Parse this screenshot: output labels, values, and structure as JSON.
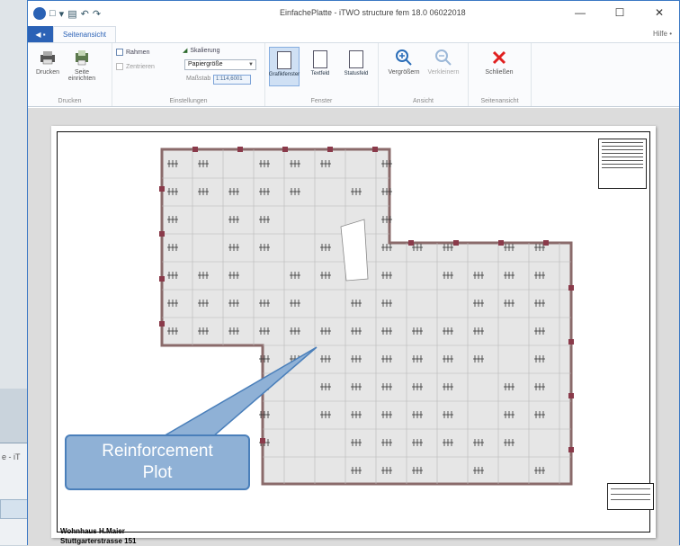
{
  "window": {
    "title": "EinfachePlatte - iTWO structure fem 18.0 06022018",
    "minimize": "—",
    "maximize": "☐",
    "close": "✕"
  },
  "tabs": {
    "file": "◀ ▪",
    "active": "Seitenansicht",
    "help": "Hilfe •"
  },
  "ribbon": {
    "drucken": {
      "print_label": "Drucken",
      "setup_label": "Seite einrichten",
      "group": "Drucken"
    },
    "einstellungen": {
      "rahmen": "Rahmen",
      "zentrieren": "Zentrieren",
      "skalierung": "Skalierung",
      "papiergroesse": "Papiergröße",
      "massstab_label": "Maßstab",
      "massstab_value": "1:114,6001",
      "group": "Einstellungen"
    },
    "fenster": {
      "buttons": [
        "Grafikfenster",
        "Textfeld",
        "Statusfeld"
      ],
      "group": "Fenster"
    },
    "ansicht": {
      "zoom_in": "Vergrößern",
      "zoom_out": "Verkleinern",
      "group": "Ansicht"
    },
    "seitenansicht": {
      "close": "Schließen",
      "group": "Seitenansicht"
    }
  },
  "sheet": {
    "caption_line1": "Wohnhaus H.Maier",
    "caption_line2": "Stuttgarterstrasse 151"
  },
  "callout": {
    "line1": "Reinforcement",
    "line2": "Plot"
  },
  "background": {
    "partial_title": "e - iT"
  }
}
